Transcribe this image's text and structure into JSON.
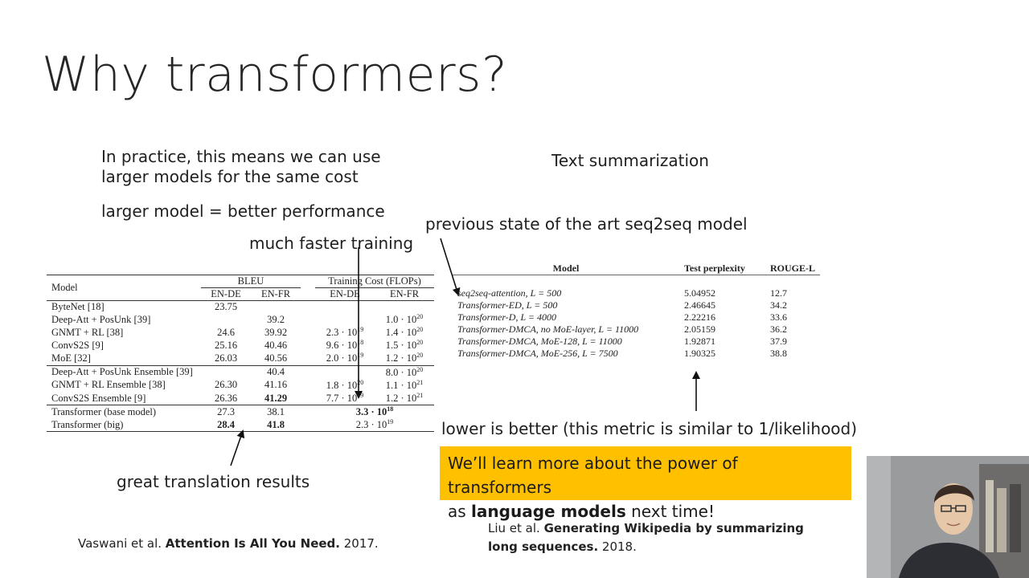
{
  "slide": {
    "title": "Why transformers?",
    "left": {
      "line1": "In practice, this means we can use",
      "line2": "larger models for the same cost",
      "line3": "larger model = better performance",
      "faster": "much faster training",
      "great": "great translation results",
      "cite_pre": "Vaswani et al. ",
      "cite_bold": "Attention Is All You Need.",
      "cite_post": " 2017."
    },
    "right": {
      "heading": "Text summarization",
      "prev": "previous state of the art seq2seq model",
      "lower": "lower is better (this metric is similar to 1/likelihood)",
      "callout_pre": "We’ll learn more about the power of transformers",
      "callout_as": "as ",
      "callout_bold": "language models",
      "callout_post": " next time!",
      "cite_pre": "Liu et al. ",
      "cite_bold1": "Generating Wikipedia by summarizing",
      "cite_bold2": "long sequences.",
      "cite_post": " 2018."
    },
    "bleu_table": {
      "h_model": "Model",
      "h_bleu": "BLEU",
      "h_cost": "Training Cost (FLOPs)",
      "h_ende": "EN-DE",
      "h_enfr": "EN-FR",
      "rows": [
        {
          "model": "ByteNet [18]",
          "bde": "23.75",
          "bfr": "",
          "cde": "",
          "cfr": ""
        },
        {
          "model": "Deep-Att + PosUnk [39]",
          "bde": "",
          "bfr": "39.2",
          "cde": "",
          "cfr": "1.0 · 10^20"
        },
        {
          "model": "GNMT + RL [38]",
          "bde": "24.6",
          "bfr": "39.92",
          "cde": "2.3 · 10^19",
          "cfr": "1.4 · 10^20"
        },
        {
          "model": "ConvS2S [9]",
          "bde": "25.16",
          "bfr": "40.46",
          "cde": "9.6 · 10^18",
          "cfr": "1.5 · 10^20"
        },
        {
          "model": "MoE [32]",
          "bde": "26.03",
          "bfr": "40.56",
          "cde": "2.0 · 10^19",
          "cfr": "1.2 · 10^20"
        },
        {
          "model": "Deep-Att + PosUnk Ensemble [39]",
          "bde": "",
          "bfr": "40.4",
          "cde": "",
          "cfr": "8.0 · 10^20"
        },
        {
          "model": "GNMT + RL Ensemble [38]",
          "bde": "26.30",
          "bfr": "41.16",
          "cde": "1.8 · 10^20",
          "cfr": "1.1 · 10^21"
        },
        {
          "model": "ConvS2S Ensemble [9]",
          "bde": "26.36",
          "bfr": "41.29",
          "cde": "7.7 · 10^19",
          "cfr": "1.2 · 10^21"
        },
        {
          "model": "Transformer (base model)",
          "bde": "27.3",
          "bfr": "38.1",
          "cost": "3.3 · 10^18"
        },
        {
          "model": "Transformer (big)",
          "bde": "28.4",
          "bfr": "41.8",
          "cost": "2.3 · 10^19"
        }
      ]
    },
    "summ_table": {
      "h_model": "Model",
      "h_ppl": "Test perplexity",
      "h_rouge": "ROUGE-L",
      "rows": [
        {
          "model": "seq2seq-attention, L = 500",
          "ppl": "5.04952",
          "rouge": "12.7"
        },
        {
          "model": "Transformer-ED, L = 500",
          "ppl": "2.46645",
          "rouge": "34.2"
        },
        {
          "model": "Transformer-D, L = 4000",
          "ppl": "2.22216",
          "rouge": "33.6"
        },
        {
          "model": "Transformer-DMCA, no MoE-layer, L = 11000",
          "ppl": "2.05159",
          "rouge": "36.2"
        },
        {
          "model": "Transformer-DMCA, MoE-128, L = 11000",
          "ppl": "1.92871",
          "rouge": "37.9"
        },
        {
          "model": "Transformer-DMCA, MoE-256, L = 7500",
          "ppl": "1.90325",
          "rouge": "38.8"
        }
      ]
    }
  }
}
